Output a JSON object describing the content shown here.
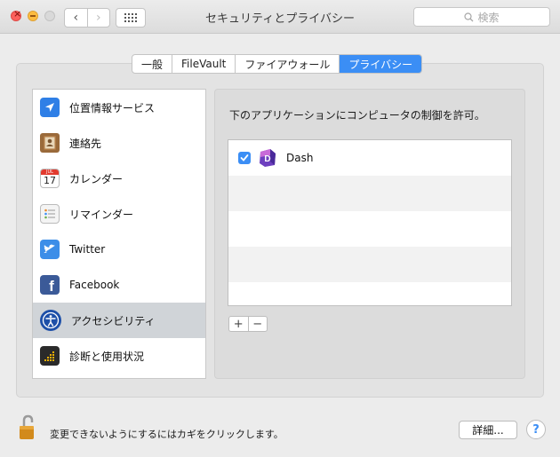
{
  "window": {
    "title": "セキュリティとプライバシー",
    "search_placeholder": "検索"
  },
  "tabs": [
    {
      "label": "一般",
      "active": false
    },
    {
      "label": "FileVault",
      "active": false
    },
    {
      "label": "ファイアウォール",
      "active": false
    },
    {
      "label": "プライバシー",
      "active": true
    }
  ],
  "sidebar": {
    "items": [
      {
        "label": "位置情報サービス",
        "icon": "location-arrow-icon"
      },
      {
        "label": "連絡先",
        "icon": "contacts-book-icon"
      },
      {
        "label": "カレンダー",
        "icon": "calendar-icon",
        "date_badge": "JUL",
        "day": "17"
      },
      {
        "label": "リマインダー",
        "icon": "reminders-icon"
      },
      {
        "label": "Twitter",
        "icon": "twitter-bird-icon"
      },
      {
        "label": "Facebook",
        "icon": "facebook-f-icon"
      },
      {
        "label": "アクセシビリティ",
        "icon": "accessibility-icon",
        "selected": true
      },
      {
        "label": "診断と使用状況",
        "icon": "diagnostics-icon"
      }
    ]
  },
  "main": {
    "title": "下のアプリケーションにコンピュータの制御を許可。",
    "apps": [
      {
        "name": "Dash",
        "checked": true,
        "icon": "dash-app-icon"
      }
    ],
    "add_label": "+",
    "remove_label": "−"
  },
  "footer": {
    "lock_text": "変更できないようにするにはカギをクリックします。",
    "advanced_label": "詳細...",
    "help_label": "?"
  },
  "colors": {
    "accent": "#3b8ef5",
    "selected_row": "#d0d4d8"
  }
}
